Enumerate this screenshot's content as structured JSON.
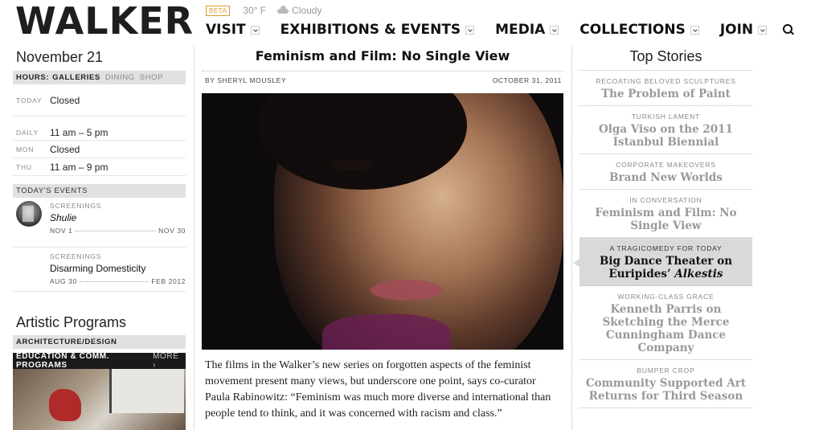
{
  "header": {
    "logo": "WALKER",
    "beta": "BETA",
    "temperature": "30° F",
    "condition": "Cloudy",
    "weather_icon": "cloud-icon",
    "nav": [
      "VISIT",
      "EXHIBITIONS & EVENTS",
      "MEDIA",
      "COLLECTIONS",
      "JOIN"
    ]
  },
  "left": {
    "date": "November 21",
    "hours_bar": {
      "label": "HOURS:",
      "active": "GALLERIES",
      "tabs": [
        "DINING",
        "SHOP"
      ]
    },
    "hours": [
      {
        "day": "TODAY",
        "time": "Closed"
      },
      {
        "day": "DAILY",
        "time": "11 am – 5 pm"
      },
      {
        "day": "MON",
        "time": "Closed"
      },
      {
        "day": "THU",
        "time": "11 am – 9 pm"
      }
    ],
    "events_header": "TODAY'S EVENTS",
    "events": [
      {
        "category": "SCREENINGS",
        "title": "Shulie",
        "start": "NOV 1",
        "end": "NOV 30"
      },
      {
        "category": "SCREENINGS",
        "title": "Disarming Domesticity",
        "start": "AUG 30",
        "end": "FEB 2012"
      }
    ],
    "programs_title": "Artistic Programs",
    "programs_bar": "ARCHITECTURE/DESIGN",
    "edu_bar": {
      "label": "EDUCATION & COMM. PROGRAMS",
      "more": "MORE ›"
    }
  },
  "article": {
    "title": "Feminism and Film: No Single View",
    "byline": "BY SHERYL MOUSLEY",
    "date": "OCTOBER 31, 2011",
    "body": "The films in the Walker’s new series on forgotten aspects of the feminist movement present many views, but underscore one point, says co-curator Paula Rabinowitz: “Feminism was much more diverse and international than people tend to think, and it was concerned with racism and class.”"
  },
  "top_stories": {
    "title": "Top Stories",
    "items": [
      {
        "kicker": "RECOATING BELOVED SCULPTURES",
        "headline": "The Problem of Paint"
      },
      {
        "kicker": "TURKISH LAMENT",
        "headline": "Olga Viso on the 2011 Istanbul Biennial"
      },
      {
        "kicker": "CORPORATE MAKEOVERS",
        "headline": "Brand New Worlds"
      },
      {
        "kicker": "IN CONVERSATION",
        "headline": "Feminism and Film: No Single View"
      },
      {
        "kicker": "A TRAGICOMEDY FOR TODAY",
        "headline": "Big Dance Theater on Euripides’",
        "headline_italic": "Alkestis"
      },
      {
        "kicker": "WORKING-CLASS GRACE",
        "headline": "Kenneth Parris on Sketching the Merce Cunningham Dance Company"
      },
      {
        "kicker": "BUMPER CROP",
        "headline": "Community Supported Art Returns for Third Season"
      }
    ]
  }
}
